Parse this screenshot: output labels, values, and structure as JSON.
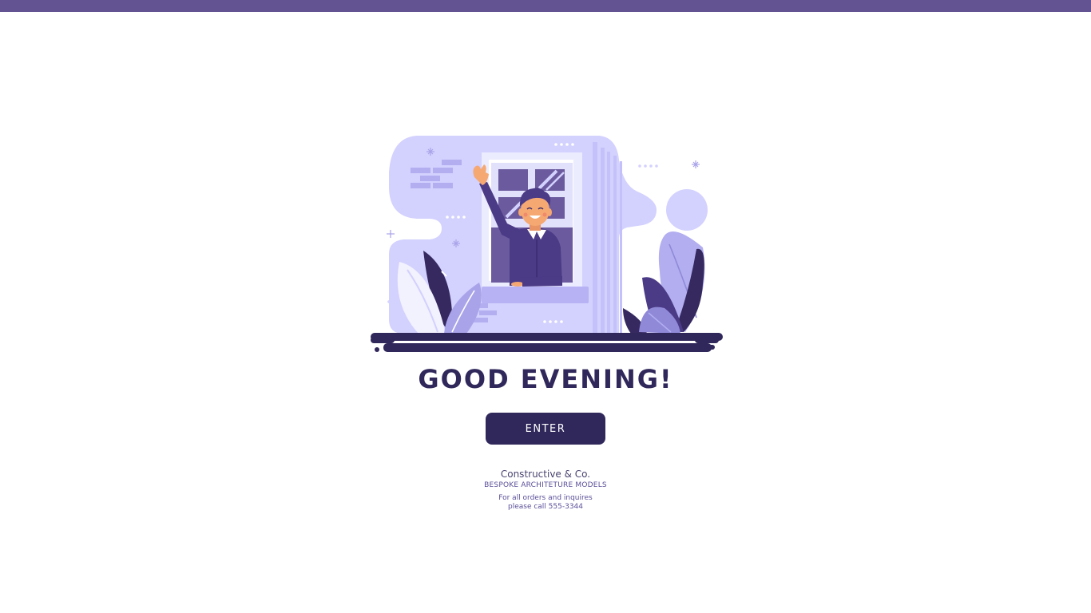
{
  "greeting": "GOOD EVENING!",
  "enter_button": {
    "label": "ENTER"
  },
  "footer": {
    "company": "Constructive & Co.",
    "tagline": "BESPOKE ARCHITETURE MODELS",
    "contact_line1": "For all orders and inquires",
    "contact_line2": "please call 555-3344"
  },
  "colors": {
    "accent_bar": "#635393",
    "dark_navy": "#30275a",
    "light_lavender": "#d3d1fe",
    "mid_purple": "#a9a4e9",
    "background": "#ffffff"
  },
  "icons": {
    "illustration": "man-waving-from-window-illustration"
  }
}
